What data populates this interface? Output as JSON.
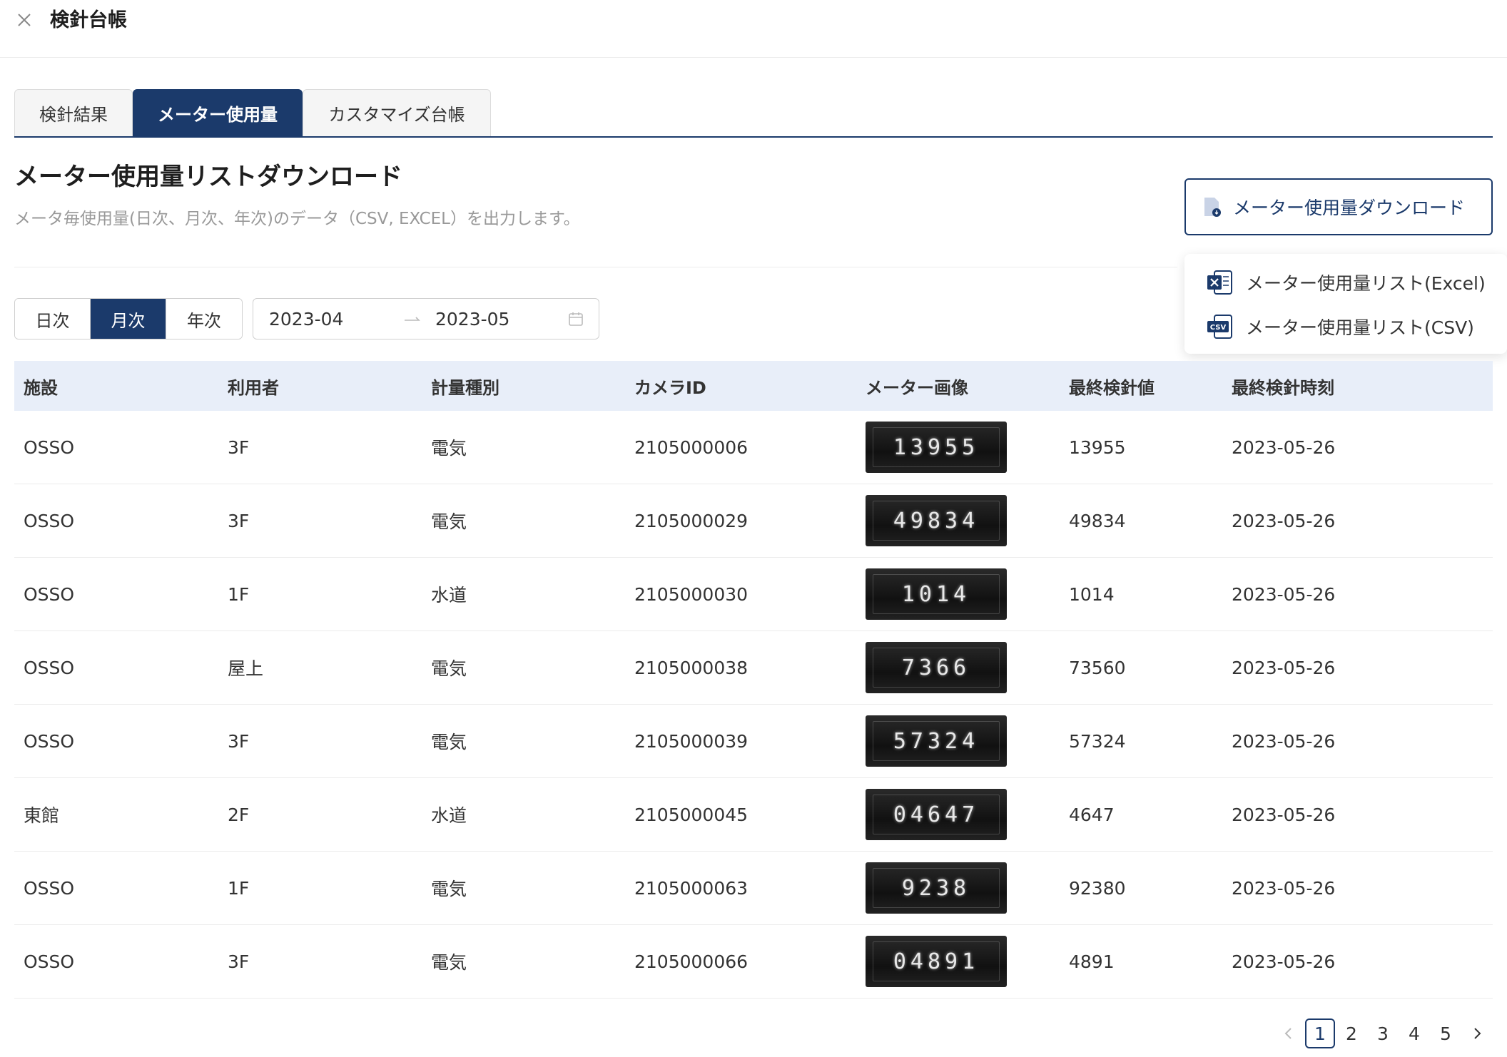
{
  "header": {
    "title": "検針台帳"
  },
  "tabs": [
    {
      "label": "検針結果",
      "active": false
    },
    {
      "label": "メーター使用量",
      "active": true
    },
    {
      "label": "カスタマイズ台帳",
      "active": false
    }
  ],
  "section": {
    "title": "メーター使用量リストダウンロード",
    "description": "メータ毎使用量(日次、月次、年次)のデータ（CSV, EXCEL）を出力します。"
  },
  "download": {
    "button_label": "メーター使用量ダウンロード",
    "options": [
      {
        "label": "メーター使用量リスト(Excel)",
        "icon": "excel-file-icon"
      },
      {
        "label": "メーター使用量リスト(CSV)",
        "icon": "csv-file-icon"
      }
    ]
  },
  "period": {
    "options": [
      "日次",
      "月次",
      "年次"
    ],
    "selected": "月次"
  },
  "date_range": {
    "start": "2023-04",
    "end": "2023-05"
  },
  "table": {
    "columns": [
      "施設",
      "利用者",
      "計量種別",
      "カメラID",
      "メーター画像",
      "最終検針値",
      "最終検針時刻"
    ],
    "rows": [
      {
        "facility": "OSSO",
        "user": "3F",
        "type": "電気",
        "camera_id": "2105000006",
        "meter_reading": "13955",
        "last_value": "13955",
        "last_time": "2023-05-26"
      },
      {
        "facility": "OSSO",
        "user": "3F",
        "type": "電気",
        "camera_id": "2105000029",
        "meter_reading": "49834",
        "last_value": "49834",
        "last_time": "2023-05-26"
      },
      {
        "facility": "OSSO",
        "user": "1F",
        "type": "水道",
        "camera_id": "2105000030",
        "meter_reading": "1014",
        "last_value": "1014",
        "last_time": "2023-05-26"
      },
      {
        "facility": "OSSO",
        "user": "屋上",
        "type": "電気",
        "camera_id": "2105000038",
        "meter_reading": "7366",
        "last_value": "73560",
        "last_time": "2023-05-26"
      },
      {
        "facility": "OSSO",
        "user": "3F",
        "type": "電気",
        "camera_id": "2105000039",
        "meter_reading": "57324",
        "last_value": "57324",
        "last_time": "2023-05-26"
      },
      {
        "facility": "東館",
        "user": "2F",
        "type": "水道",
        "camera_id": "2105000045",
        "meter_reading": "04647",
        "last_value": "4647",
        "last_time": "2023-05-26"
      },
      {
        "facility": "OSSO",
        "user": "1F",
        "type": "電気",
        "camera_id": "2105000063",
        "meter_reading": "9238",
        "last_value": "92380",
        "last_time": "2023-05-26"
      },
      {
        "facility": "OSSO",
        "user": "3F",
        "type": "電気",
        "camera_id": "2105000066",
        "meter_reading": "04891",
        "last_value": "4891",
        "last_time": "2023-05-26"
      }
    ]
  },
  "pagination": {
    "pages": [
      "1",
      "2",
      "3",
      "4",
      "5"
    ],
    "current": "1"
  },
  "colors": {
    "primary": "#1b3a6b",
    "header_bg": "#e8eef9",
    "muted_text": "#999999"
  }
}
